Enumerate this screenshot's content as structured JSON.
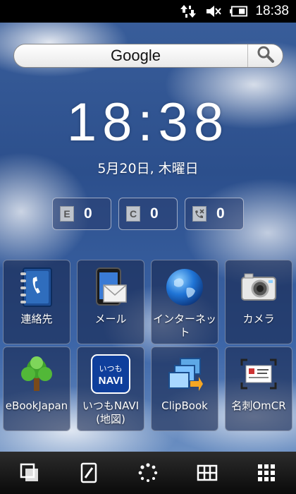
{
  "status": {
    "time": "18:38",
    "icons": [
      "network-transfer-icon",
      "mute-icon",
      "battery-icon"
    ]
  },
  "search": {
    "label": "Google",
    "icon": "search-icon"
  },
  "clock": {
    "time": "18:38",
    "date": "5月20日, 木曜日"
  },
  "counters": [
    {
      "badge": "E",
      "value": "0",
      "icon": "email-icon"
    },
    {
      "badge": "C",
      "value": "0",
      "icon": "message-icon"
    },
    {
      "badge": "",
      "value": "0",
      "icon": "missed-call-icon"
    }
  ],
  "apps": [
    {
      "label": "連絡先",
      "icon": "contacts-icon"
    },
    {
      "label": "メール",
      "icon": "mail-icon"
    },
    {
      "label": "インターネッ\nト",
      "icon": "globe-icon"
    },
    {
      "label": "カメラ",
      "icon": "camera-icon"
    },
    {
      "label": "eBookJapan",
      "icon": "tree-icon"
    },
    {
      "label": "いつもNAVI\n(地図)",
      "icon": "navi-icon",
      "badge_text": "いつも\nNAVI"
    },
    {
      "label": "ClipBook",
      "icon": "clipbook-icon"
    },
    {
      "label": "名刺OmCR",
      "icon": "business-card-icon"
    }
  ],
  "dock": [
    "windows-icon",
    "pen-icon",
    "loading-icon",
    "grid-icon",
    "app-menu-icon"
  ],
  "colors": {
    "wallpaper_sky": "#2c4f8c",
    "status_bar": "#000000",
    "dock": "#1a1a1a"
  }
}
